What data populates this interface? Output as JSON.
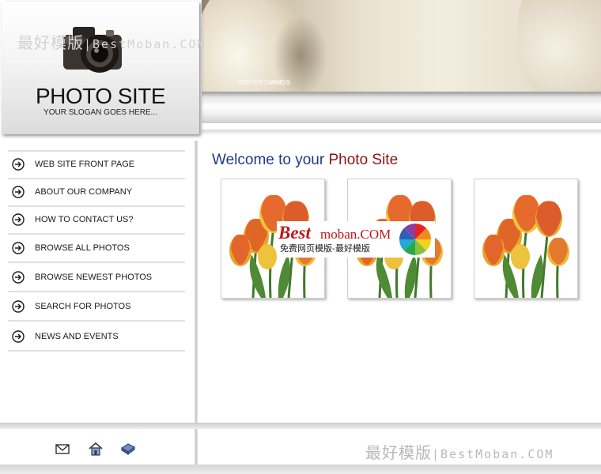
{
  "header": {
    "site_title": "PHOTO SITE",
    "slogan": "YOUR SLOGAN GOES HERE...",
    "banner_caption_light": "INSPIRED",
    "banner_caption_bold": "MINDS"
  },
  "watermarks": {
    "top_cjk": "最好模版",
    "top_latin": "|BestMoban.COM",
    "mid_best": "Best",
    "mid_moban": "moban.COM",
    "mid_sub": "免费网页模版-最好模版",
    "bottom_cjk": "最好模版",
    "bottom_latin": "|BestMoban.COM"
  },
  "nav": {
    "items": [
      {
        "label": "WEB SITE FRONT PAGE",
        "icon": "arrow-circle-icon"
      },
      {
        "label": "ABOUT OUR COMPANY",
        "icon": "arrow-circle-icon"
      },
      {
        "label": "HOW TO CONTACT US?",
        "icon": "arrow-circle-icon"
      },
      {
        "label": "BROWSE ALL PHOTOS",
        "icon": "arrow-circle-icon"
      },
      {
        "label": "BROWSE NEWEST PHOTOS",
        "icon": "arrow-circle-icon"
      },
      {
        "label": "SEARCH FOR PHOTOS",
        "icon": "arrow-circle-icon"
      },
      {
        "label": "NEWS AND EVENTS",
        "icon": "arrow-circle-icon"
      }
    ]
  },
  "main": {
    "welcome_prefix": "Welcome to your ",
    "welcome_highlight": "Photo Site",
    "photos": [
      {
        "subject": "tulips",
        "icon": "tulip-photo"
      },
      {
        "subject": "tulips",
        "icon": "tulip-photo"
      },
      {
        "subject": "tulips",
        "icon": "tulip-photo"
      }
    ]
  },
  "footer": {
    "icons": [
      "mail-icon",
      "home-icon",
      "bookmark-icon"
    ]
  },
  "colors": {
    "welcome_blue": "#1f3a86",
    "welcome_red": "#8c1414",
    "watermark_red": "#c0171b",
    "divider_gray": "#e0e0e0"
  }
}
